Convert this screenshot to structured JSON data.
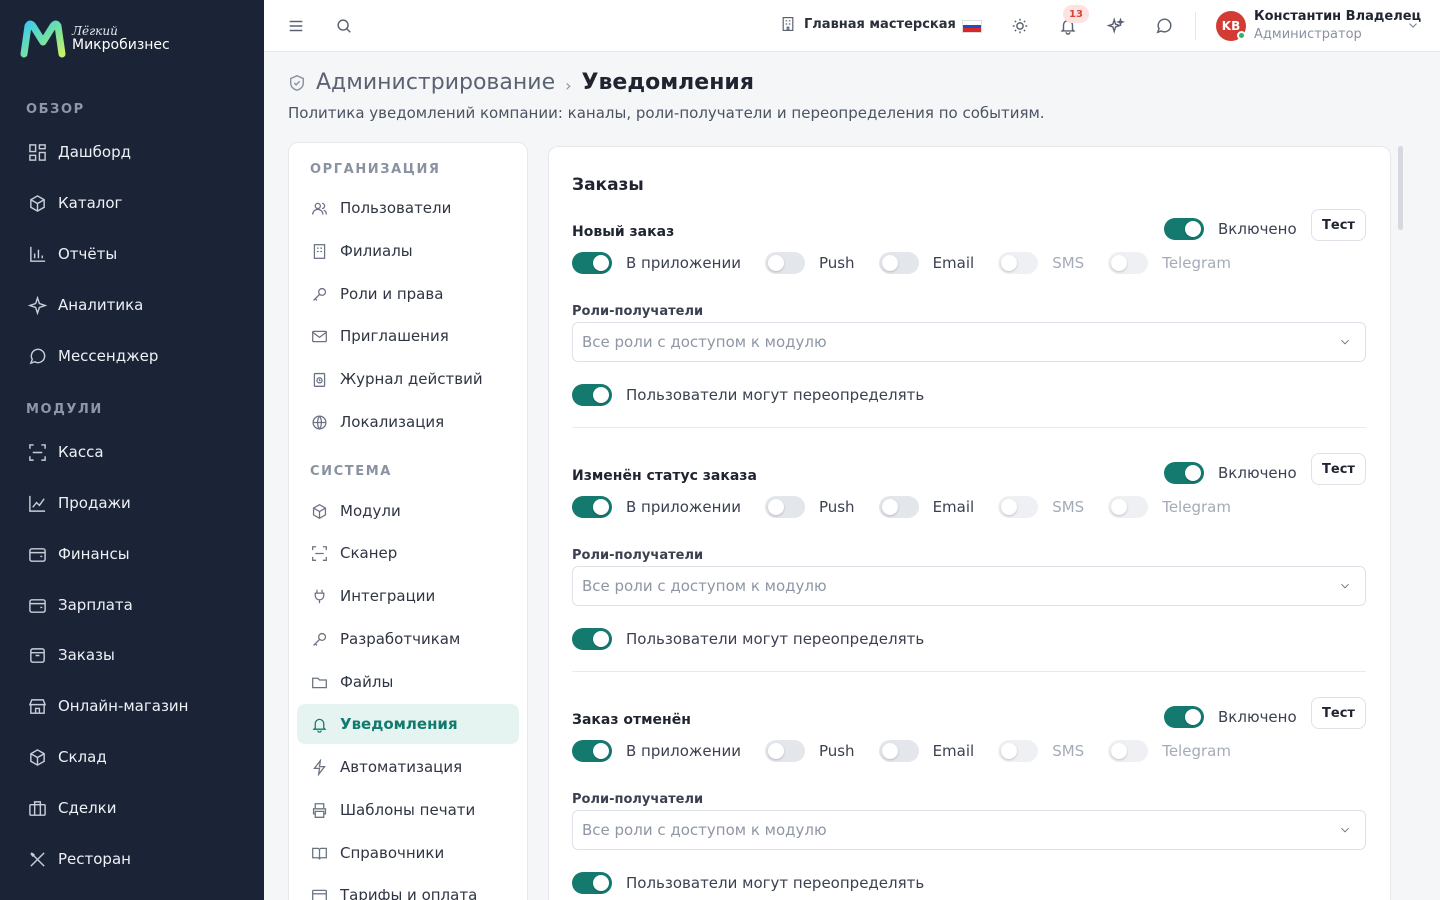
{
  "brand": {
    "small": "Лёгкий",
    "big": "Микробизнес"
  },
  "sidebar": {
    "sections": [
      {
        "title": "ОБЗОР",
        "items": [
          {
            "label": "Дашборд",
            "icon": "dashboard-icon"
          },
          {
            "label": "Каталог",
            "icon": "catalog-icon"
          },
          {
            "label": "Отчёты",
            "icon": "reports-icon"
          },
          {
            "label": "Аналитика",
            "icon": "sparkle-icon"
          },
          {
            "label": "Мессенджер",
            "icon": "chat-icon"
          }
        ]
      },
      {
        "title": "МОДУЛИ",
        "items": [
          {
            "label": "Касса",
            "icon": "scan-icon"
          },
          {
            "label": "Продажи",
            "icon": "chart-line-icon"
          },
          {
            "label": "Финансы",
            "icon": "wallet-icon"
          },
          {
            "label": "Зарплата",
            "icon": "wallet-icon"
          },
          {
            "label": "Заказы",
            "icon": "box-icon"
          },
          {
            "label": "Онлайн-магазин",
            "icon": "store-icon"
          },
          {
            "label": "Склад",
            "icon": "cube-icon"
          },
          {
            "label": "Сделки",
            "icon": "briefcase-icon"
          },
          {
            "label": "Ресторан",
            "icon": "utensils-icon"
          }
        ]
      }
    ]
  },
  "topbar": {
    "workspace": "Главная мастерская",
    "notifications_count": "13",
    "user": {
      "initials": "KB",
      "name": "Константин Владелец",
      "role": "Администратор"
    }
  },
  "page": {
    "breadcrumb_parent": "Администрирование",
    "breadcrumb_sep": "›",
    "title": "Уведомления",
    "description": "Политика уведомлений компании: каналы, роли-получатели и переопределения по событиям."
  },
  "settings_nav": {
    "org_title": "ОРГАНИЗАЦИЯ",
    "org_items": [
      "Пользователи",
      "Филиалы",
      "Роли и права",
      "Приглашения",
      "Журнал действий",
      "Локализация"
    ],
    "sys_title": "СИСТЕМА",
    "sys_items": [
      "Модули",
      "Сканер",
      "Интеграции",
      "Разработчикам",
      "Файлы",
      "Уведомления",
      "Автоматизация",
      "Шаблоны печати",
      "Справочники",
      "Тарифы и оплата"
    ],
    "active": "Уведомления"
  },
  "content": {
    "section_title": "Заказы",
    "enabled_label": "Включено",
    "test_label": "Тест",
    "roles_label": "Роли-получатели",
    "roles_placeholder": "Все роли с доступом к модулю",
    "override_label": "Пользователи могут переопределять",
    "channels": [
      {
        "label": "В приложении",
        "on": true,
        "disabled": false
      },
      {
        "label": "Push",
        "on": false,
        "disabled": false
      },
      {
        "label": "Email",
        "on": false,
        "disabled": false
      },
      {
        "label": "SMS",
        "on": false,
        "disabled": true
      },
      {
        "label": "Telegram",
        "on": false,
        "disabled": true
      }
    ],
    "events": [
      {
        "name": "Новый заказ"
      },
      {
        "name": "Изменён статус заказа"
      },
      {
        "name": "Заказ отменён"
      }
    ]
  },
  "colors": {
    "accent": "#147a6f",
    "sidebar_bg": "#1b2436",
    "badge": "#d9443a"
  }
}
